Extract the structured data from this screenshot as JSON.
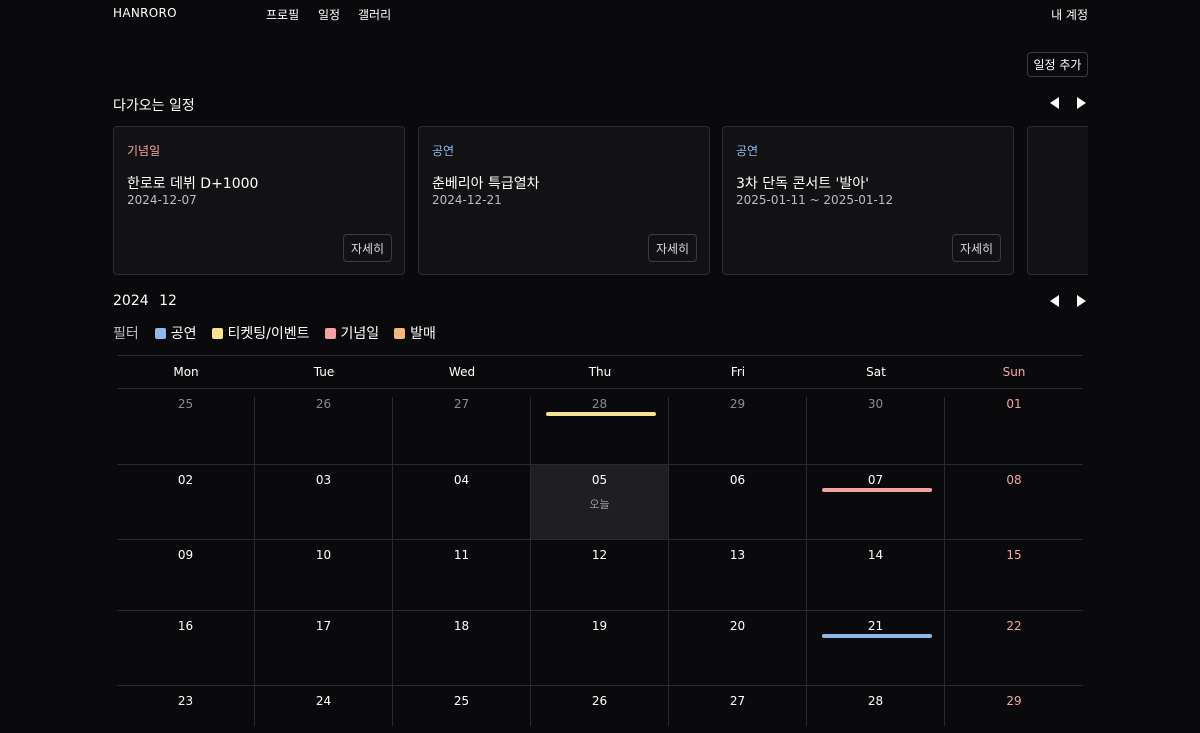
{
  "nav": {
    "brand": "HANRORO",
    "links": [
      "프로필",
      "일정",
      "갤러리"
    ],
    "account": "내 계정"
  },
  "toolbar": {
    "add_label": "일정 추가"
  },
  "upcoming": {
    "title": "다가오는 일정",
    "cards": [
      {
        "category": "기념일",
        "category_color": "#f4a3a3",
        "title": "한로로 데뷔 D+1000",
        "date": "2024-12-07",
        "button": "자세히"
      },
      {
        "category": "공연",
        "category_color": "#8fb8ef",
        "title": "춘베리아 특급열차",
        "date": "2024-12-21",
        "button": "자세히"
      },
      {
        "category": "공연",
        "category_color": "#8fb8ef",
        "title": "3차 단독 콘서트 '발아'",
        "date": "2025-01-11 ~ 2025-01-12",
        "button": "자세히"
      }
    ]
  },
  "calendar": {
    "year": "2024",
    "month": "12",
    "filter_label": "필터",
    "filters": [
      {
        "label": "공연",
        "color": "#8fb8ef"
      },
      {
        "label": "티켓팅/이벤트",
        "color": "#f7e28f"
      },
      {
        "label": "기념일",
        "color": "#f4a3a3"
      },
      {
        "label": "발매",
        "color": "#f5b776"
      }
    ],
    "weekdays": [
      "Mon",
      "Tue",
      "Wed",
      "Thu",
      "Fri",
      "Sat",
      "Sun"
    ],
    "today_label": "오늘",
    "weeks": [
      [
        "25",
        "26",
        "27",
        "28",
        "29",
        "30",
        "01"
      ],
      [
        "02",
        "03",
        "04",
        "05",
        "06",
        "07",
        "08"
      ],
      [
        "09",
        "10",
        "11",
        "12",
        "13",
        "14",
        "15"
      ],
      [
        "16",
        "17",
        "18",
        "19",
        "20",
        "21",
        "22"
      ],
      [
        "23",
        "24",
        "25",
        "26",
        "27",
        "28",
        "29"
      ]
    ],
    "events": [
      {
        "week": 0,
        "day": 3,
        "color": "#f7e28f"
      },
      {
        "week": 1,
        "day": 5,
        "color": "#f4a3a3"
      },
      {
        "week": 3,
        "day": 5,
        "color": "#8fb8ef"
      }
    ],
    "colors": {
      "text": "#ffffff",
      "muted": "#8a8a90",
      "sunday": "#f4a3a3"
    }
  }
}
